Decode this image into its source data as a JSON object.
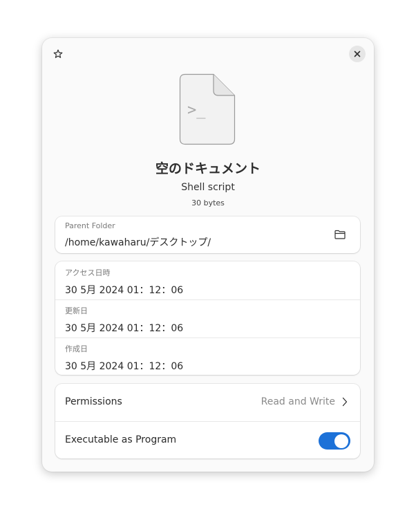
{
  "header": {
    "star_icon": "star-outline-icon",
    "close_icon": "close-icon"
  },
  "file": {
    "icon": "shell-script-file-icon",
    "icon_glyph": ">_",
    "name": "空のドキュメント",
    "type": "Shell script",
    "size": "30 bytes"
  },
  "location": {
    "label": "Parent Folder",
    "path": "/home/kawaharu/デスクトップ/",
    "open_icon": "folder-icon"
  },
  "dates": [
    {
      "label": "アクセス日時",
      "value": "30 5月 2024 01：12：06"
    },
    {
      "label": "更新日",
      "value": "30 5月 2024 01：12：06"
    },
    {
      "label": "作成日",
      "value": "30 5月 2024 01：12：06"
    }
  ],
  "permissions": {
    "label": "Permissions",
    "value": "Read and Write",
    "chevron_icon": "chevron-right-icon"
  },
  "executable": {
    "label": "Executable as Program",
    "enabled": true
  },
  "colors": {
    "accent": "#1c71d8",
    "dialog_bg": "#fafafa",
    "card_bg": "#ffffff"
  }
}
